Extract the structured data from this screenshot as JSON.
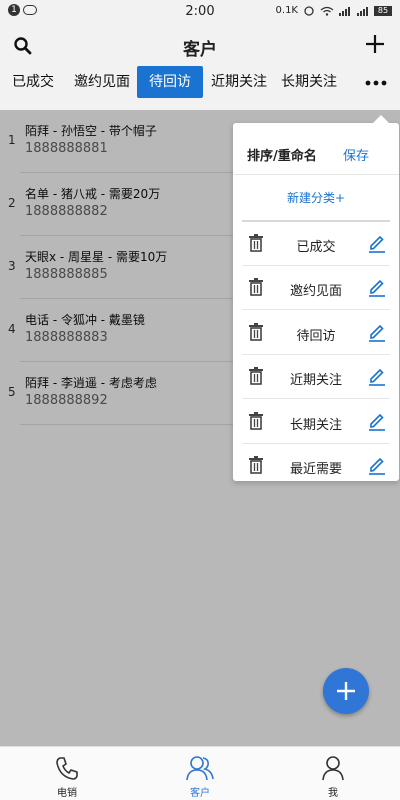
{
  "status_bar": {
    "time": "2:00",
    "net_speed": "0.1K",
    "battery": "85"
  },
  "header": {
    "title": "客户"
  },
  "tabs": [
    {
      "label": "已成交"
    },
    {
      "label": "邀约见面"
    },
    {
      "label": "待回访",
      "active": true
    },
    {
      "label": "近期关注"
    },
    {
      "label": "长期关注"
    }
  ],
  "customers": [
    {
      "index": "1",
      "name": "陌拜 - 孙悟空 - 带个帽子",
      "phone": "1888888881"
    },
    {
      "index": "2",
      "name": "名单 - 猪八戒 - 需要20万",
      "phone": "1888888882"
    },
    {
      "index": "3",
      "name": "天眼x - 周星星 - 需要10万",
      "phone": "1888888885"
    },
    {
      "index": "4",
      "name": "电话 - 令狐冲 - 戴墨镜",
      "phone": "1888888883"
    },
    {
      "index": "5",
      "name": "陌拜 - 李逍遥 - 考虑考虑",
      "phone": "1888888892"
    }
  ],
  "popup": {
    "title": "排序/重命名",
    "save_label": "保存",
    "new_category_label": "新建分类+",
    "categories": [
      {
        "label": "已成交"
      },
      {
        "label": "邀约见面"
      },
      {
        "label": "待回访"
      },
      {
        "label": "近期关注"
      },
      {
        "label": "长期关注"
      },
      {
        "label": "最近需要"
      }
    ]
  },
  "bottom_nav": [
    {
      "label": "电销",
      "icon": "phone-icon"
    },
    {
      "label": "客户",
      "icon": "customers-icon",
      "active": true
    },
    {
      "label": "我",
      "icon": "person-icon"
    }
  ],
  "colors": {
    "accent": "#1a73d1",
    "fab": "#2f76d6"
  }
}
